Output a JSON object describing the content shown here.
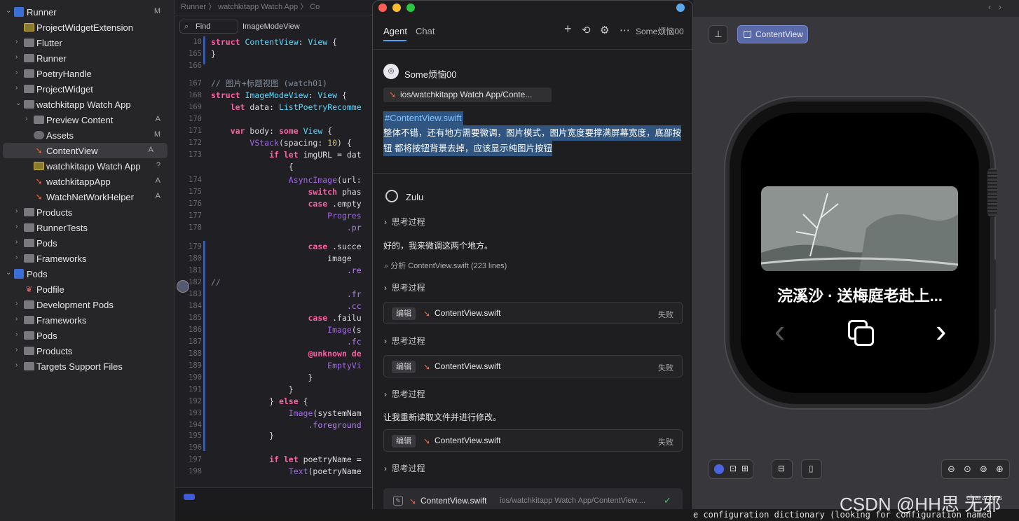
{
  "navigator": {
    "items": [
      {
        "label": "Runner",
        "badge": "M",
        "depth": 0,
        "kind": "proj",
        "chev": "⌄"
      },
      {
        "label": "ProjectWidgetExtension",
        "badge": "",
        "depth": 1,
        "kind": "ext",
        "chev": ""
      },
      {
        "label": "Flutter",
        "badge": "",
        "depth": 1,
        "kind": "folder",
        "chev": "›"
      },
      {
        "label": "Runner",
        "badge": "",
        "depth": 1,
        "kind": "folder",
        "chev": "›"
      },
      {
        "label": "PoetryHandle",
        "badge": "",
        "depth": 1,
        "kind": "folder",
        "chev": "›"
      },
      {
        "label": "ProjectWidget",
        "badge": "",
        "depth": 1,
        "kind": "folder",
        "chev": "›"
      },
      {
        "label": "watchkitapp Watch App",
        "badge": "",
        "depth": 1,
        "kind": "folder",
        "chev": "⌄"
      },
      {
        "label": "Preview Content",
        "badge": "A",
        "depth": 2,
        "kind": "folder",
        "chev": "›"
      },
      {
        "label": "Assets",
        "badge": "M",
        "depth": 2,
        "kind": "asset",
        "chev": ""
      },
      {
        "label": "ContentView",
        "badge": "A",
        "depth": 2,
        "kind": "swift",
        "chev": "",
        "selected": true
      },
      {
        "label": "watchkitapp Watch App",
        "badge": "?",
        "depth": 2,
        "kind": "ext",
        "chev": ""
      },
      {
        "label": "watchkitappApp",
        "badge": "A",
        "depth": 2,
        "kind": "swift",
        "chev": ""
      },
      {
        "label": "WatchNetWorkHelper",
        "badge": "A",
        "depth": 2,
        "kind": "swift",
        "chev": ""
      },
      {
        "label": "Products",
        "badge": "",
        "depth": 1,
        "kind": "folder",
        "chev": "›"
      },
      {
        "label": "RunnerTests",
        "badge": "",
        "depth": 1,
        "kind": "folder",
        "chev": "›"
      },
      {
        "label": "Pods",
        "badge": "",
        "depth": 1,
        "kind": "folder",
        "chev": "›"
      },
      {
        "label": "Frameworks",
        "badge": "",
        "depth": 1,
        "kind": "folder",
        "chev": "›"
      },
      {
        "label": "Pods",
        "badge": "",
        "depth": 0,
        "kind": "proj",
        "chev": "⌄"
      },
      {
        "label": "Podfile",
        "badge": "",
        "depth": 1,
        "kind": "podfile",
        "chev": ""
      },
      {
        "label": "Development Pods",
        "badge": "",
        "depth": 1,
        "kind": "folder",
        "chev": "›"
      },
      {
        "label": "Frameworks",
        "badge": "",
        "depth": 1,
        "kind": "folder",
        "chev": "›"
      },
      {
        "label": "Pods",
        "badge": "",
        "depth": 1,
        "kind": "folder",
        "chev": "›"
      },
      {
        "label": "Products",
        "badge": "",
        "depth": 1,
        "kind": "folder",
        "chev": "›"
      },
      {
        "label": "Targets Support Files",
        "badge": "",
        "depth": 1,
        "kind": "folder",
        "chev": "›"
      }
    ]
  },
  "editor": {
    "breadcrumb": "Runner 〉 watchkitapp Watch App 〉 Co",
    "find_mode": "Find",
    "find_query": "ImageModeView",
    "lines": [
      {
        "n": "10",
        "html": "<span class='kw'>struct</span> <span class='ty'>ContentView</span>: <span class='ty'>View</span> {"
      },
      {
        "n": "165",
        "html": "}"
      },
      {
        "n": "166",
        "html": ""
      },
      {
        "n": "167",
        "html": "<span class='cm'>// 图片+标题视图 (watch01)</span>"
      },
      {
        "n": "168",
        "html": "<span class='kw'>struct</span> <span class='ty'>ImageModeView</span>: <span class='ty'>View</span> {"
      },
      {
        "n": "169",
        "html": "    <span class='kw'>let</span> data: <span class='ty'>ListPoetryRecomme</span>"
      },
      {
        "n": "170",
        "html": ""
      },
      {
        "n": "171",
        "html": "    <span class='kw'>var</span> body: <span class='kw'>some</span> <span class='ty'>View</span> {"
      },
      {
        "n": "172",
        "html": "        <span class='fn'>VStack</span>(spacing: <span class='nm'>10</span>) {"
      },
      {
        "n": "173",
        "html": "            <span class='kw'>if let</span> imgURL = dat"
      },
      {
        "n": "",
        "html": "                {"
      },
      {
        "n": "174",
        "html": "                <span class='fn'>AsyncImage</span>(url:"
      },
      {
        "n": "175",
        "html": "                    <span class='kw'>switch</span> phas"
      },
      {
        "n": "176",
        "html": "                    <span class='kw'>case</span> .empty"
      },
      {
        "n": "177",
        "html": "                        <span class='fn'>Progres</span>"
      },
      {
        "n": "178",
        "html": "                            <span class='pr'>.pr</span>"
      },
      {
        "n": "",
        "html": ""
      },
      {
        "n": "179",
        "html": "                    <span class='kw'>case</span> .succe"
      },
      {
        "n": "180",
        "html": "                        image"
      },
      {
        "n": "181",
        "html": "                            <span class='pr'>.re</span>"
      },
      {
        "n": "182",
        "html": "<span class='cm'>//</span>"
      },
      {
        "n": "183",
        "html": "                            <span class='pr'>.fr</span>"
      },
      {
        "n": "184",
        "html": "                            <span class='pr'>.cc</span>"
      },
      {
        "n": "185",
        "html": "                    <span class='kw'>case</span> .failu"
      },
      {
        "n": "186",
        "html": "                        <span class='fn'>Image</span>(s"
      },
      {
        "n": "187",
        "html": "                            <span class='pr'>.fc</span>"
      },
      {
        "n": "188",
        "html": "                    <span class='kw'>@unknown de</span>"
      },
      {
        "n": "189",
        "html": "                        <span class='fn'>EmptyVi</span>"
      },
      {
        "n": "190",
        "html": "                    }"
      },
      {
        "n": "191",
        "html": "                }"
      },
      {
        "n": "192",
        "html": "            } <span class='kw'>else</span> {"
      },
      {
        "n": "193",
        "html": "                <span class='fn'>Image</span>(systemNam"
      },
      {
        "n": "194",
        "html": "                    <span class='pr'>.foreground</span>"
      },
      {
        "n": "195",
        "html": "            }"
      },
      {
        "n": "196",
        "html": ""
      },
      {
        "n": "197",
        "html": "            <span class='kw'>if let</span> poetryName ="
      },
      {
        "n": "198",
        "html": "                <span class='fn'>Text</span>(poetryName"
      }
    ]
  },
  "chat": {
    "tabs": [
      "Agent",
      "Chat"
    ],
    "account": "Some烦恼00",
    "user_name": "Some烦恼00",
    "context_file": "ios/watchkitapp Watch App/Conte...",
    "user_tag": "#ContentView.swift",
    "user_message_1": "整体不错，还有地方需要微调，图片模式，图片宽度要撑满屏幕宽度，底部按",
    "user_message_2": "钮 都将按钮背景去掉，应该显示纯图片按钮",
    "assistant_name": "Zulu",
    "thinking": "思考过程",
    "reply_1": "好的，我来微调这两个地方。",
    "analyze": "分析 ContentView.swift (223 lines)",
    "edit_tag": "编辑",
    "edit_file": "ContentView.swift",
    "edit_status": "失败",
    "reply_2": "让我重新读取文件并进行修改。",
    "final_file": "ContentView.swift",
    "final_path": "ios/watchkitapp Watch App/ContentView...."
  },
  "preview": {
    "pin_label": "",
    "view_button": "ContentView",
    "watch_title": "浣溪沙 · 送梅庭老赴上..."
  },
  "console": {
    "text": "e configuration dictionary (looking for configuration named",
    "overlay": "characters"
  },
  "watermark": "CSDN @HH思 无邪",
  "colors": {
    "accent": "#4fa3ff",
    "selection": "#2f5580",
    "swift": "#f0613d",
    "view_button": "#5a6aa8"
  }
}
